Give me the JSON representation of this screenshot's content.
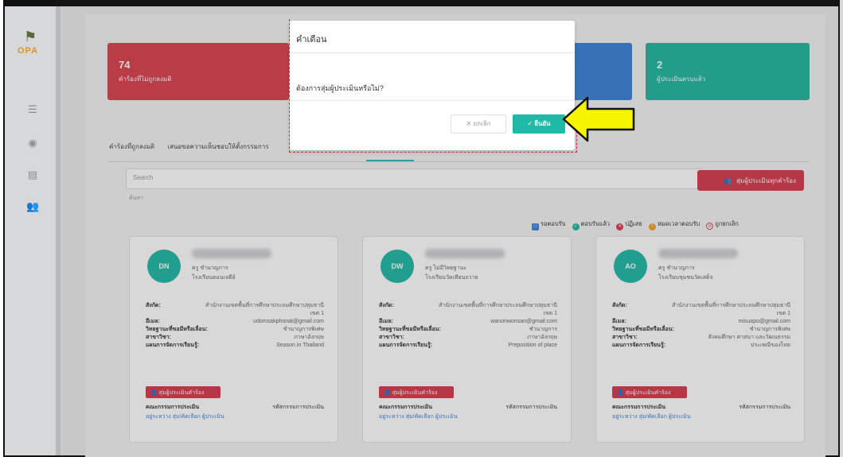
{
  "sidebar": {
    "logo_text": "OPA",
    "icons": [
      "list-icon",
      "user-circle-icon",
      "document-icon",
      "users-icon"
    ]
  },
  "stats": [
    {
      "value": "74",
      "label": "คำร้องที่ไม่ถูกลงมติ",
      "color": "#d9414e"
    },
    {
      "value": "",
      "label": "",
      "color": "#3b83d6"
    },
    {
      "value": "2",
      "label": "ผู้ประเมินครบแล้ว",
      "color": "#22b7a0"
    }
  ],
  "tabs": [
    "คำร้องที่ถูกลงมติ",
    "เสนอขอความเห็นชอบให้ตั้งกรรมการ"
  ],
  "search": {
    "placeholder": "Search",
    "label": "ค้นหา"
  },
  "random_button": {
    "label": "สุ่มผู้ประเมินทุกคำร้อง"
  },
  "legend": [
    {
      "label": "รอตอบรับ",
      "color": "#3b83d6"
    },
    {
      "label": "ตอบรับแล้ว",
      "color": "#22b7a0"
    },
    {
      "label": "ปฏิเสธ",
      "color": "#d63b4d"
    },
    {
      "label": "หมดเวลาตอบรับ",
      "color": "#f0a030"
    },
    {
      "label": "ถูกยกเลิก",
      "color": "#d63b4d"
    }
  ],
  "field_labels": {
    "affiliation": "สังกัด:",
    "email": "อีเมล:",
    "qualification": "วิทยฐานะที่ขอมีหรือเลื่อน:",
    "subject": "สาขาวิชา:",
    "learning_plan": "แผนการจัดการเรียนรู้:",
    "random_assessor": "สุ่มผู้ประเมินคำร้อง",
    "committee": "คณะกรรมการประเมิน",
    "assess_code": "รหัสกรรมการประเมิน",
    "actions": "อยู่ระหว่าง สุ่ม/คัดเลือก ผู้ประเมิน"
  },
  "cards": [
    {
      "initials": "DN",
      "role": "ครู ชำนาญการ",
      "school": "โรงเรียนดอนเจดีย์",
      "affiliation": "สำนักงานเขตพื้นที่การศึกษาประถมศึกษาปทุมธานี เขต 1",
      "email": "udomsakphonat@gmail.com",
      "qualification": "ชำนาญการพิเศษ",
      "subject": "ภาษาอังกฤษ",
      "learning_plan": "Season in Thailand"
    },
    {
      "initials": "DW",
      "role": "ครู ไม่มีวิทยฐานะ",
      "school": "โรงเรียนวัดเทียนถวาย",
      "affiliation": "สำนักงานเขตพื้นที่การศึกษาประถมศึกษาปทุมธานี เขต 1",
      "email": "wanonwonsan@gmail.com",
      "qualification": "ชำนาญการ",
      "subject": "ภาษาอังกฤษ",
      "learning_plan": "Preposition of place"
    },
    {
      "initials": "AO",
      "role": "ครู ชำนาญการ",
      "school": "โรงเรียนชุมชนวัดเสด็จ",
      "affiliation": "สำนักงานเขตพื้นที่การศึกษาประถมศึกษาปทุมธานี เขต 1",
      "email": "misuapo@gmail.com",
      "qualification": "ชำนาญการพิเศษ",
      "subject": "สังคมศึกษา ศาสนา และวัฒนธรรม",
      "learning_plan": "ประเพณีของไทย"
    }
  ],
  "modal": {
    "title": "คำเตือน",
    "message": "ต้องการสุ่มผู้ประเมินหรือไม่?",
    "cancel_label": "ยกเลิก",
    "confirm_label": "ยืนยัน"
  },
  "colors": {
    "accent_teal": "#22b7a0",
    "danger_red": "#d63b4d",
    "annotation_arrow": "#f7f400"
  }
}
